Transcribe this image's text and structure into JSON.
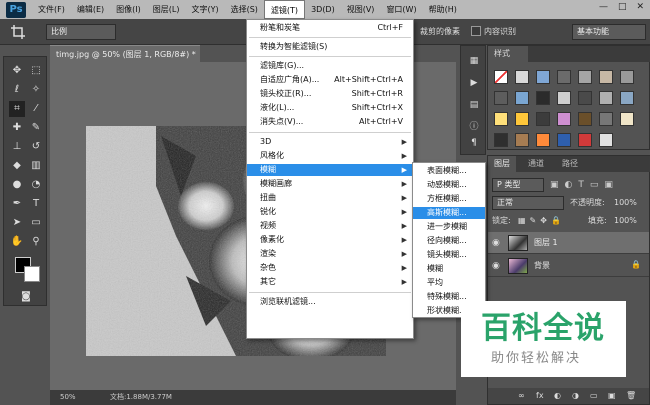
{
  "menubar": {
    "logo": "Ps",
    "items": [
      "文件(F)",
      "编辑(E)",
      "图像(I)",
      "图层(L)",
      "文字(Y)",
      "选择(S)",
      "滤镜(T)",
      "3D(D)",
      "视图(V)",
      "窗口(W)",
      "帮助(H)"
    ],
    "active_index": 6,
    "win_min": "—",
    "win_max": "□",
    "win_close": "✕"
  },
  "options": {
    "ratio_select": "比例",
    "right_text": "裁剪的像素",
    "content_aware_label": "内容识别",
    "workspace": "基本功能"
  },
  "document": {
    "tab_title": "timg.jpg @ 50% (图层 1, RGB/8#) *",
    "tab_close": "×",
    "zoom": "50%",
    "doc_info": "文档:1.88M/3.77M"
  },
  "filter_menu": {
    "items": [
      {
        "label": "粉笔和炭笔",
        "shortcut": "Ctrl+F"
      },
      {
        "label": "转换为智能滤镜(S)",
        "shortcut": ""
      },
      {
        "label": "滤镜库(G)...",
        "shortcut": ""
      },
      {
        "label": "自适应广角(A)...",
        "shortcut": "Alt+Shift+Ctrl+A"
      },
      {
        "label": "镜头校正(R)...",
        "shortcut": "Shift+Ctrl+R"
      },
      {
        "label": "液化(L)...",
        "shortcut": "Shift+Ctrl+X"
      },
      {
        "label": "消失点(V)...",
        "shortcut": "Alt+Ctrl+V"
      },
      {
        "label": "3D",
        "shortcut": ""
      },
      {
        "label": "风格化",
        "shortcut": ""
      },
      {
        "label": "模糊",
        "shortcut": ""
      },
      {
        "label": "模糊画廊",
        "shortcut": ""
      },
      {
        "label": "扭曲",
        "shortcut": ""
      },
      {
        "label": "锐化",
        "shortcut": ""
      },
      {
        "label": "视频",
        "shortcut": ""
      },
      {
        "label": "像素化",
        "shortcut": ""
      },
      {
        "label": "渲染",
        "shortcut": ""
      },
      {
        "label": "杂色",
        "shortcut": ""
      },
      {
        "label": "其它",
        "shortcut": ""
      },
      {
        "label": "浏览联机滤镜...",
        "shortcut": ""
      }
    ],
    "submenu_arrow": "▶"
  },
  "blur_menu": {
    "items": [
      "表面模糊...",
      "动感模糊...",
      "方框模糊...",
      "高斯模糊...",
      "进一步模糊",
      "径向模糊...",
      "镜头模糊...",
      "模糊",
      "平均",
      "特殊模糊...",
      "形状模糊..."
    ]
  },
  "styles_panel": {
    "tab": "样式",
    "swatch_colors": [
      "#ffffff",
      "#d9d9d9",
      "#7fa7d6",
      "#6b6b6b",
      "#a5a5a5",
      "#c7b8a5",
      "#9a9a9a",
      "#5d5d5d",
      "#7aa6d2",
      "#2b2b2b",
      "#cfcfcf",
      "#4a4a4a",
      "#b0b0b0",
      "#8aa7c4",
      "#ffe07a",
      "#ffc73a",
      "#3c3c3c",
      "#cf8fd1",
      "#6a4f2a",
      "#777777",
      "#f0e5c8",
      "#2f2f2f",
      "#a67c52",
      "#ff8a3a",
      "#2e5fae",
      "#d13a3a",
      "#e0e0e0"
    ]
  },
  "layers_panel": {
    "tabs": [
      "图层",
      "通道",
      "路径"
    ],
    "kind_select": "P 类型",
    "blend_select": "正常",
    "opacity_label": "不透明度:",
    "opacity_value": "100%",
    "lock_label": "锁定:",
    "fill_label": "填充:",
    "fill_value": "100%",
    "layers": [
      {
        "name": "图层 1",
        "lock": ""
      },
      {
        "name": "背景",
        "lock": "🔒"
      }
    ],
    "footer_icons": [
      "∞",
      "fx",
      "◐",
      "◑",
      "▭",
      "▣",
      "🗑"
    ]
  },
  "watermark": {
    "title": "百科全说",
    "subtitle": "助你轻松解决"
  }
}
